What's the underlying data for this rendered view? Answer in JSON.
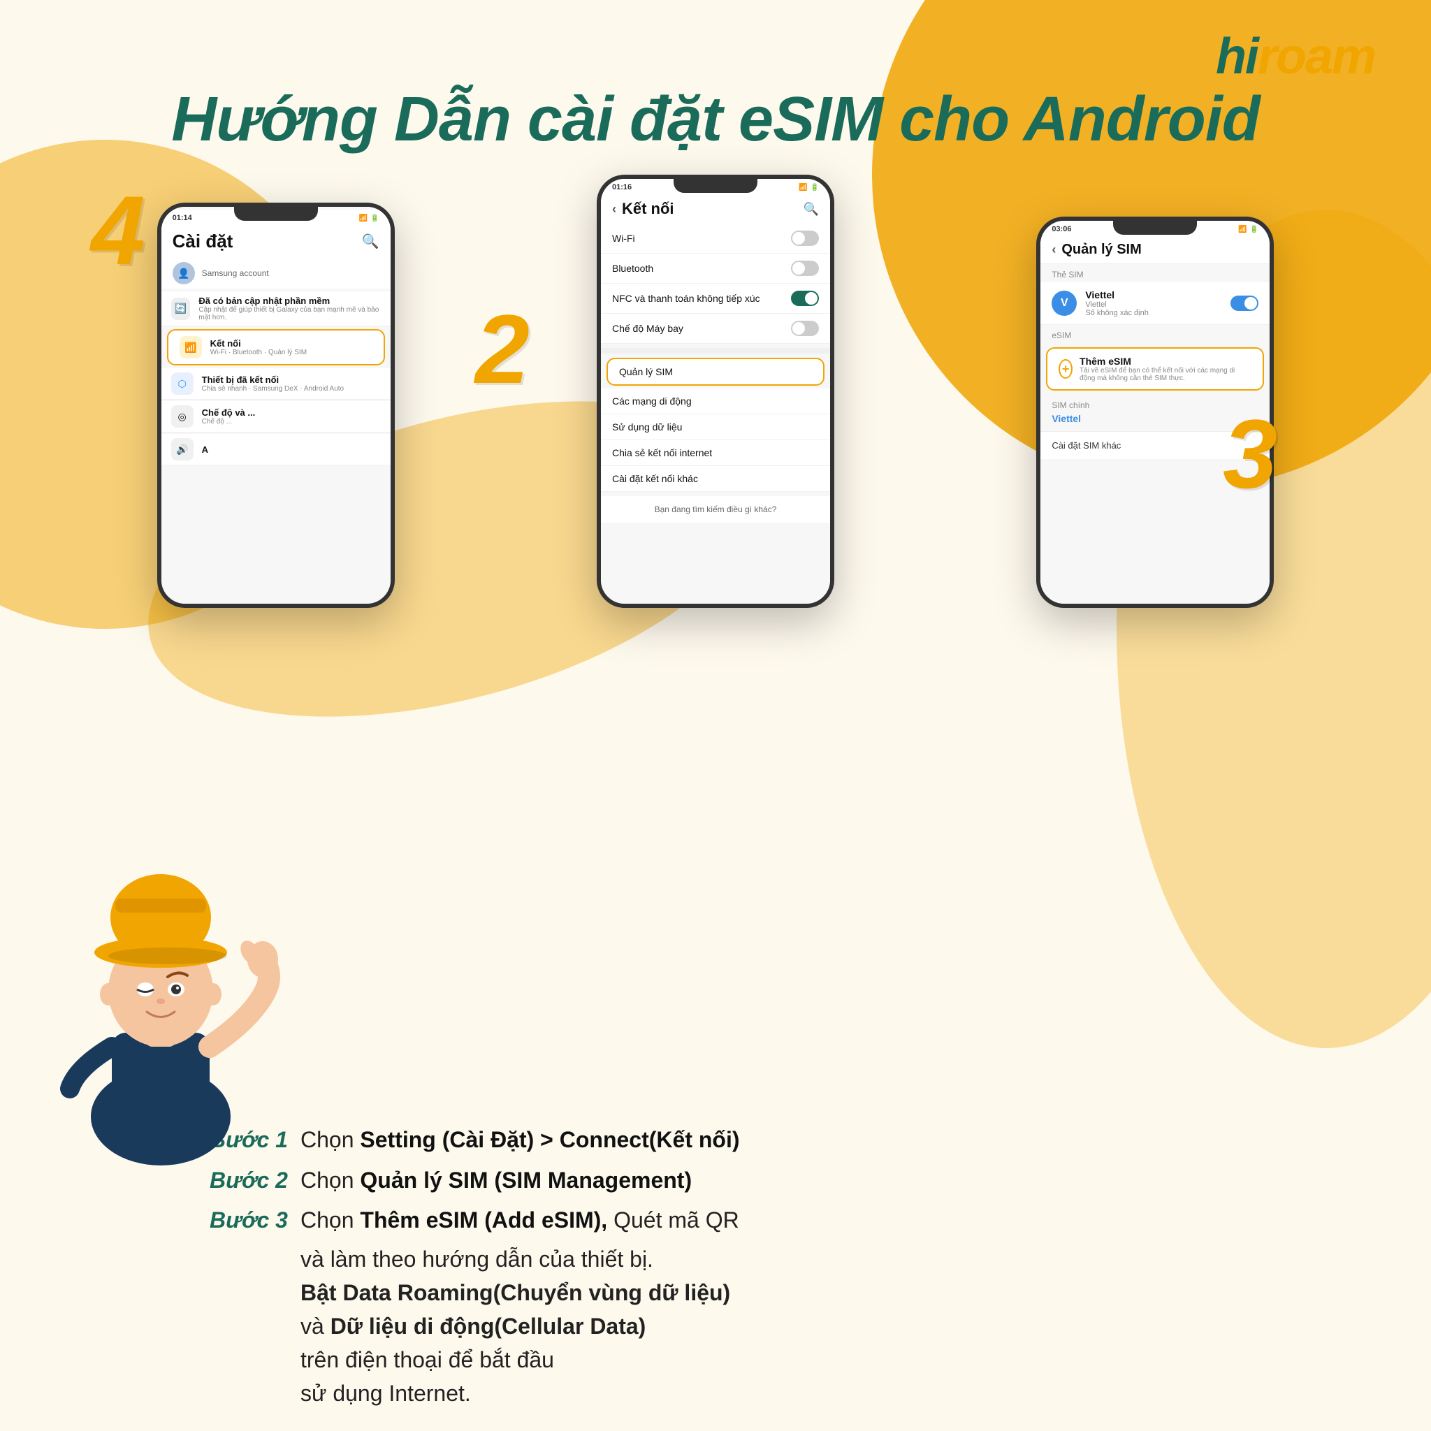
{
  "brand": {
    "name_hi": "hi",
    "name_roam": "roam"
  },
  "title": "Hướng Dẫn cài đặt eSIM cho Android",
  "phone1": {
    "time": "01:14",
    "screen_title": "Cài đặt",
    "samsung_account": "Samsung account",
    "items": [
      {
        "title": "Đã có bản cập nhật phần mềm",
        "sub": "Cập nhật để giúp thiết bị Galaxy của bạn mạnh mẽ và bảo mật hơn.",
        "icon": "⟳",
        "color": "#888"
      },
      {
        "title": "Kết nối",
        "sub": "Wi-Fi · Bluetooth · Quản lý SIM",
        "icon": "📶",
        "color": "#f0a500",
        "highlighted": true
      },
      {
        "title": "Thiết bị đã kết nối",
        "sub": "Chia sẻ nhanh · Samsung DeX · Android Auto",
        "icon": "⬡",
        "color": "#3a8ee6"
      },
      {
        "title": "Chế độ và ...",
        "sub": "Chế độ ...",
        "icon": "◎",
        "color": "#888"
      }
    ],
    "step": "4"
  },
  "phone2": {
    "time": "01:16",
    "screen_title": "Kết nối",
    "items": [
      {
        "label": "Wi-Fi",
        "toggle": false
      },
      {
        "label": "Bluetooth",
        "toggle": false
      },
      {
        "label": "NFC và thanh toán không tiếp xúc",
        "toggle": true
      },
      {
        "label": "Chế độ Máy bay",
        "toggle": false
      }
    ],
    "highlighted_item": "Quản lý SIM",
    "extra_items": [
      "Các mạng di động",
      "Sử dụng dữ liệu",
      "Chia sẻ kết nối internet",
      "Cài đặt kết nối khác"
    ],
    "bottom_link": "Bạn đang tìm kiếm điều gì khác?",
    "step": "2"
  },
  "phone3": {
    "time": "03:06",
    "screen_title": "Quản lý SIM",
    "the_sim_label": "Thẻ SIM",
    "sim_item": {
      "name": "Viettel",
      "operator": "Viettel",
      "number": "Số không xác định",
      "avatar_letter": "V"
    },
    "esim_label": "eSIM",
    "esim_add": {
      "title": "Thêm eSIM",
      "description": "Tải về eSIM để bạn có thể kết nối với các mạng di động mà không cần thẻ SIM thực."
    },
    "sim_main_label": "SIM chính",
    "sim_main_value": "Viettel",
    "other_settings": "Cài đặt SIM khác",
    "step": "3"
  },
  "steps": [
    {
      "label": "Bước 1",
      "text_normal": "Chọn ",
      "text_bold": "Setting (Cài Đặt) > Connect(Kết nối)"
    },
    {
      "label": "Bước 2",
      "text_normal": "Chọn ",
      "text_bold": "Quản lý SIM (SIM Management)"
    },
    {
      "label": "Bước 3",
      "text_normal": "Chọn ",
      "text_bold": "Thêm eSIM (Add eSIM),",
      "text_after": " Quét mã QR",
      "line2": "và làm theo hướng dẫn của thiết bị.",
      "line3_bold": "Bật Data Roaming(Chuyển vùng dữ liệu)",
      "line4": "và ",
      "line4_bold": "Dữ liệu di động(Cellular Data)",
      "line5": "trên điện thoại để bắt đầu",
      "line6": "sử dụng Internet."
    }
  ]
}
